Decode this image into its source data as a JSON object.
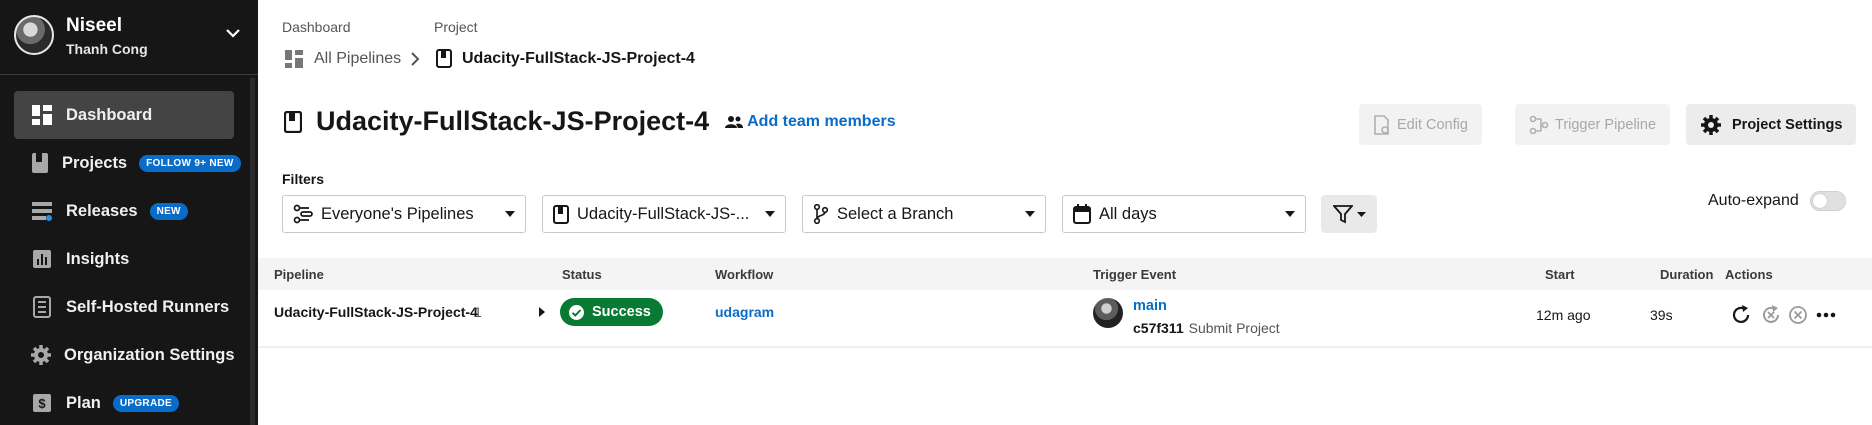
{
  "org": {
    "name": "Niseel",
    "user": "Thanh Cong"
  },
  "sidebar": {
    "items": [
      {
        "label": "Dashboard",
        "icon": "dashboard-icon",
        "active": true
      },
      {
        "label": "Projects",
        "icon": "projects-icon",
        "badge": "FOLLOW 9+ NEW"
      },
      {
        "label": "Releases",
        "icon": "releases-icon",
        "badge": "NEW"
      },
      {
        "label": "Insights",
        "icon": "insights-icon"
      },
      {
        "label": "Self-Hosted Runners",
        "icon": "runners-icon"
      },
      {
        "label": "Organization Settings",
        "icon": "gear-icon"
      },
      {
        "label": "Plan",
        "icon": "plan-icon",
        "badge": "UPGRADE"
      }
    ]
  },
  "breadcrumb": {
    "dashboard_label": "Dashboard",
    "project_label": "Project",
    "all_pipelines": "All Pipelines",
    "current_project": "Udacity-FullStack-JS-Project-4"
  },
  "header": {
    "title": "Udacity-FullStack-JS-Project-4",
    "add_team": "Add team members",
    "edit_config": "Edit Config",
    "trigger_pipeline": "Trigger Pipeline",
    "project_settings": "Project Settings"
  },
  "filters": {
    "label": "Filters",
    "pipelines": "Everyone's Pipelines",
    "project": "Udacity-FullStack-JS-...",
    "branch": "Select a Branch",
    "days": "All days",
    "auto_expand": "Auto-expand"
  },
  "table": {
    "headers": {
      "pipeline": "Pipeline",
      "status": "Status",
      "workflow": "Workflow",
      "trigger": "Trigger Event",
      "start": "Start",
      "duration": "Duration",
      "actions": "Actions"
    },
    "rows": [
      {
        "pipeline": "Udacity-FullStack-JS-Project-4",
        "number": "1",
        "status": "Success",
        "workflow": "udagram",
        "branch": "main",
        "commit_sha": "c57f311",
        "commit_msg": "Submit Project",
        "start": "12m ago",
        "duration": "39s"
      }
    ]
  },
  "colors": {
    "accent": "#0a6cc9",
    "success": "#087a33",
    "sidebar": "#161616"
  }
}
